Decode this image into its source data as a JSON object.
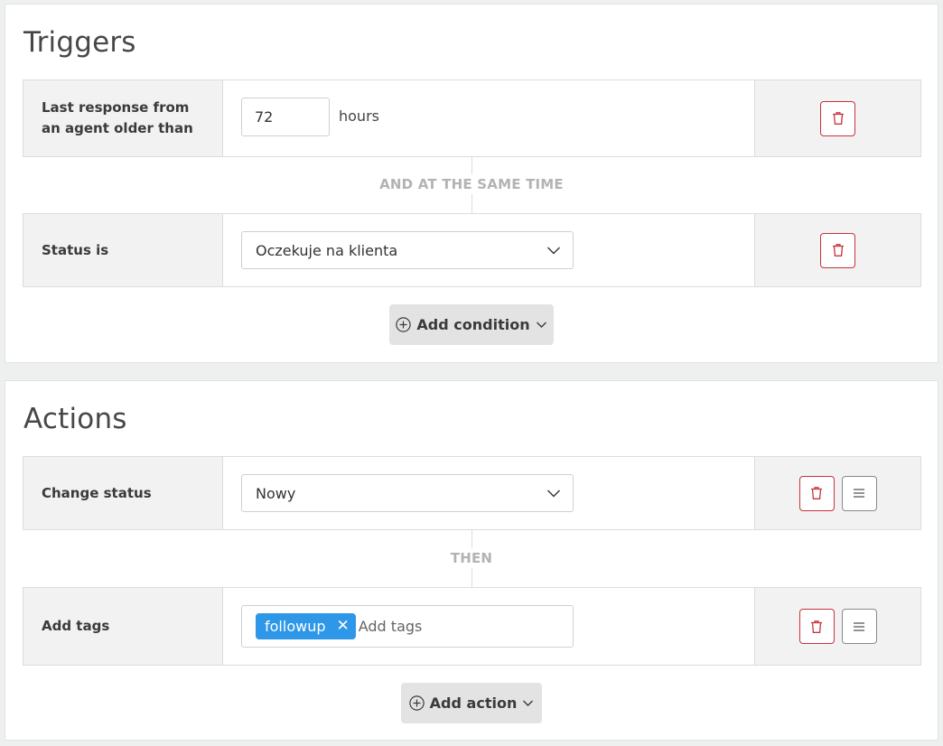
{
  "triggers": {
    "title": "Triggers",
    "conditions": [
      {
        "label": "Last response from an agent older than",
        "value": "72",
        "unit": "hours"
      },
      {
        "label": "Status is",
        "selected": "Oczekuje na klienta"
      }
    ],
    "connector": "AND AT THE SAME TIME",
    "add_label": "Add condition"
  },
  "actions": {
    "title": "Actions",
    "items": [
      {
        "label": "Change status",
        "selected": "Nowy"
      },
      {
        "label": "Add tags",
        "tags": [
          "followup"
        ],
        "placeholder": "Add tags",
        "tag_remove": "✕"
      }
    ],
    "connector": "THEN",
    "add_label": "Add action"
  },
  "icons": {
    "delete": "trash-icon",
    "drag": "menu-icon",
    "add": "plus-circle-icon",
    "chevron": "chevron-down-icon"
  },
  "colors": {
    "delete_accent": "#c8323c",
    "tag_bg": "#2f97e8",
    "connector_text": "#b3b3b3",
    "page_bg": "#eef0ef"
  }
}
